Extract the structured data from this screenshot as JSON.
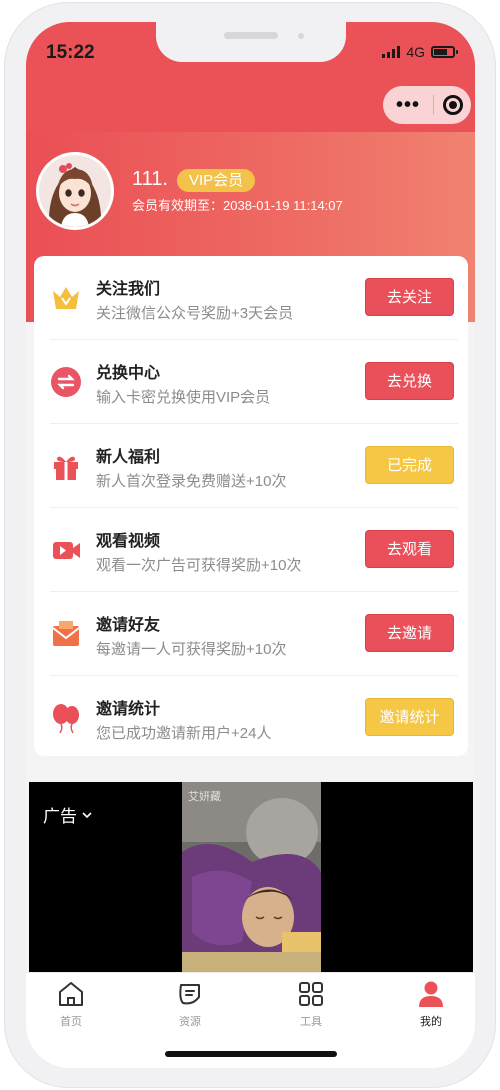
{
  "status_bar": {
    "time": "15:22",
    "network": "4G"
  },
  "capsule": {
    "more_icon": "ellipsis-icon",
    "close_icon": "target-icon"
  },
  "profile": {
    "name": "111.",
    "badge": "VIP会员",
    "expire": "会员有效期至：2038-01-19 11:14:07"
  },
  "tasks": [
    {
      "icon": "crown-icon",
      "title": "关注我们",
      "desc": "关注微信公众号奖励+3天会员",
      "button": "去关注",
      "button_color": "#e9505a"
    },
    {
      "icon": "exchange-icon",
      "title": "兑换中心",
      "desc": "输入卡密兑换使用VIP会员",
      "button": "去兑换",
      "button_color": "#e9505a"
    },
    {
      "icon": "gift-icon",
      "title": "新人福利",
      "desc": "新人首次登录免费赠送+10次",
      "button": "已完成",
      "button_color": "#f6c744"
    },
    {
      "icon": "video-icon",
      "title": "观看视频",
      "desc": "观看一次广告可获得奖励+10次",
      "button": "去观看",
      "button_color": "#e9505a"
    },
    {
      "icon": "envelope-icon",
      "title": "邀请好友",
      "desc": "每邀请一人可获得奖励+10次",
      "button": "去邀请",
      "button_color": "#e9505a"
    },
    {
      "icon": "balloons-icon",
      "title": "邀请统计",
      "desc": "您已成功邀请新用户+24人",
      "button": "邀请统计",
      "button_color": "#f6c744"
    }
  ],
  "ad": {
    "label": "广告",
    "watermark": "艾妍藏"
  },
  "tabbar": [
    {
      "label": "首页",
      "icon": "home-icon",
      "active": false
    },
    {
      "label": "资源",
      "icon": "resource-icon",
      "active": false
    },
    {
      "label": "工具",
      "icon": "grid-icon",
      "active": false
    },
    {
      "label": "我的",
      "icon": "profile-icon",
      "active": true
    }
  ],
  "colors": {
    "accent": "#ea5257",
    "yellow": "#f6c744"
  }
}
